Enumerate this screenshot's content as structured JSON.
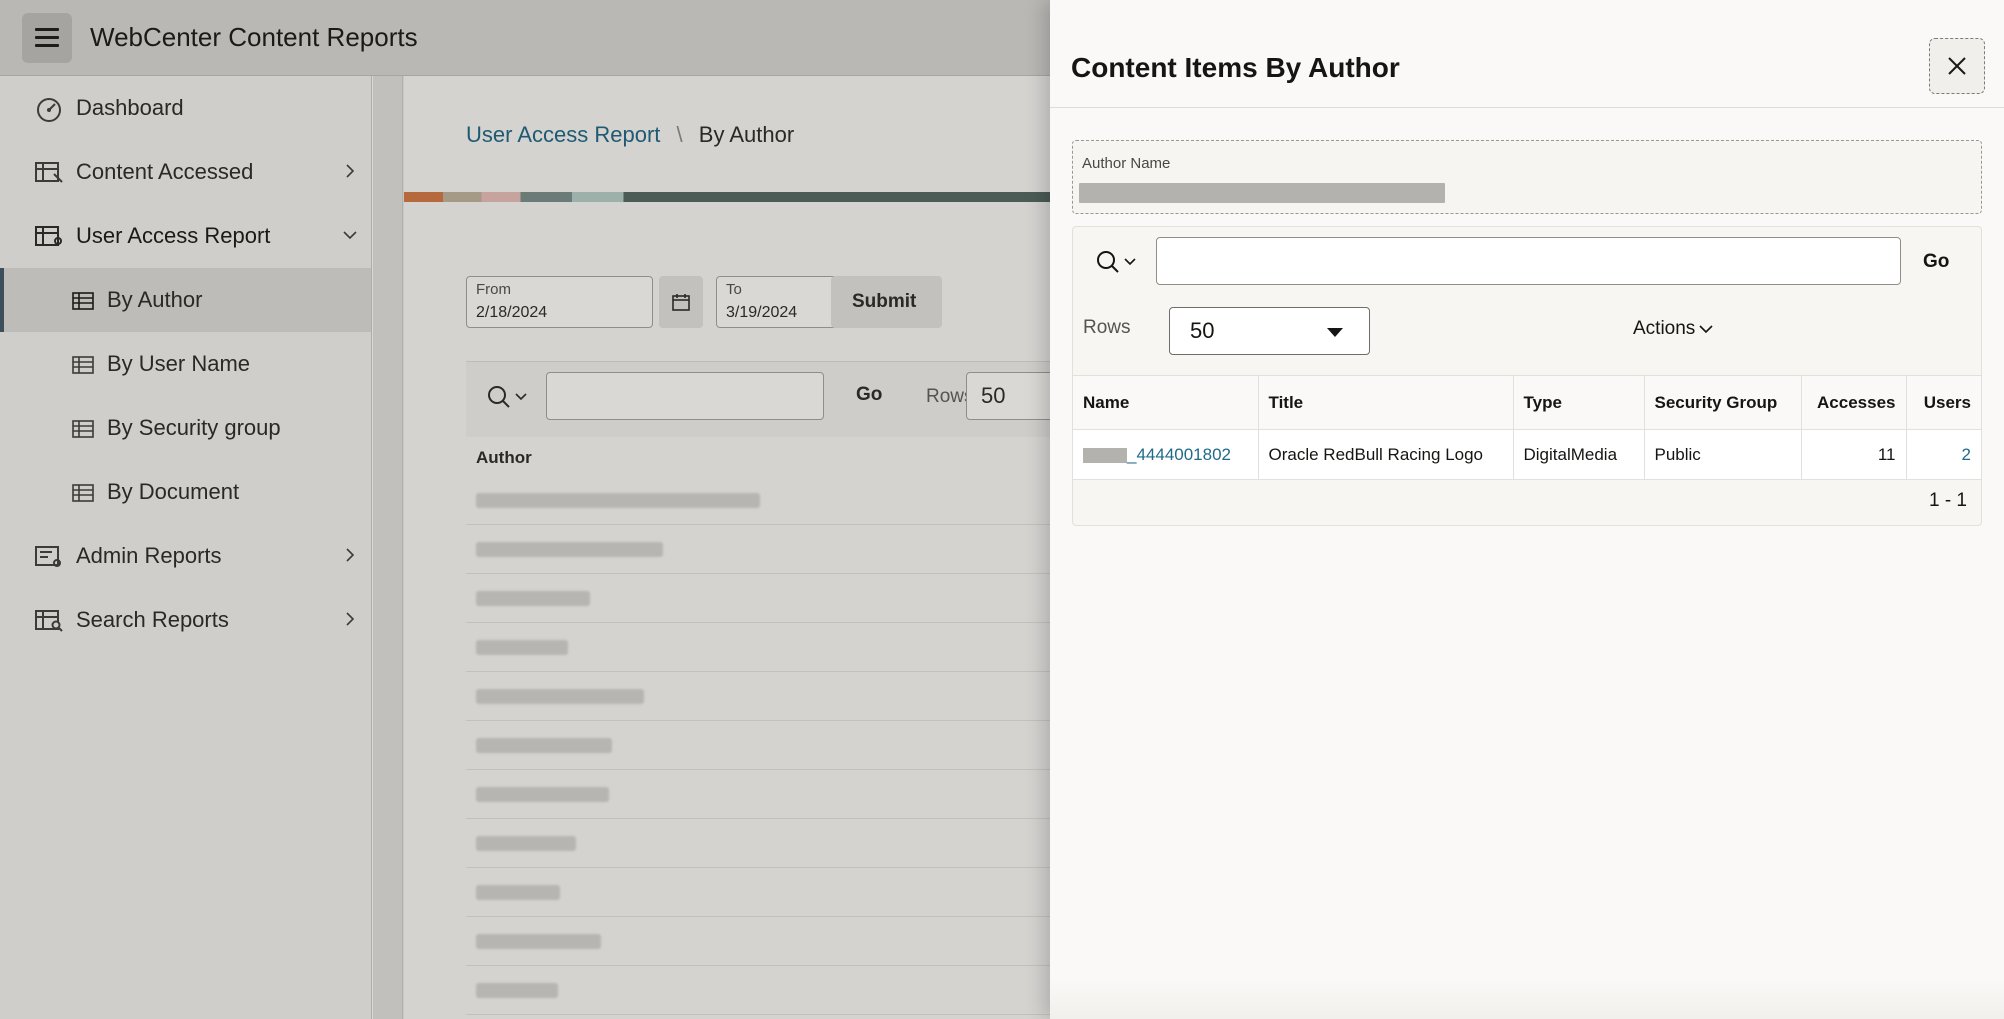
{
  "app": {
    "title": "WebCenter Content Reports"
  },
  "sidebar": {
    "items": [
      {
        "label": "Dashboard"
      },
      {
        "label": "Content Accessed"
      },
      {
        "label": "User Access Report"
      },
      {
        "label": "By Author"
      },
      {
        "label": "By User Name"
      },
      {
        "label": "By Security group"
      },
      {
        "label": "By Document"
      },
      {
        "label": "Admin Reports"
      },
      {
        "label": "Search Reports"
      }
    ]
  },
  "main": {
    "breadcrumb": {
      "parent": "User Access Report",
      "separator": "\\",
      "current": "By Author"
    },
    "from": {
      "label": "From",
      "value": "2/18/2024"
    },
    "to": {
      "label": "To",
      "value": "3/19/2024"
    },
    "submit_label": "Submit",
    "toolbar": {
      "go_label": "Go",
      "rows_label": "Rows",
      "rows_value": "50"
    },
    "table": {
      "column": "Author"
    }
  },
  "drawer": {
    "title": "Content Items By Author",
    "author_label": "Author Name",
    "go_label": "Go",
    "rows_label": "Rows",
    "rows_value": "50",
    "actions_label": "Actions",
    "columns": [
      "Name",
      "Title",
      "Type",
      "Security Group",
      "Accesses",
      "Users"
    ],
    "rows": [
      {
        "name": "_4444001802",
        "title": "Oracle RedBull Racing Logo",
        "type": "DigitalMedia",
        "security_group": "Public",
        "accesses": "11",
        "users": "2"
      }
    ],
    "pagination": "1 - 1"
  }
}
